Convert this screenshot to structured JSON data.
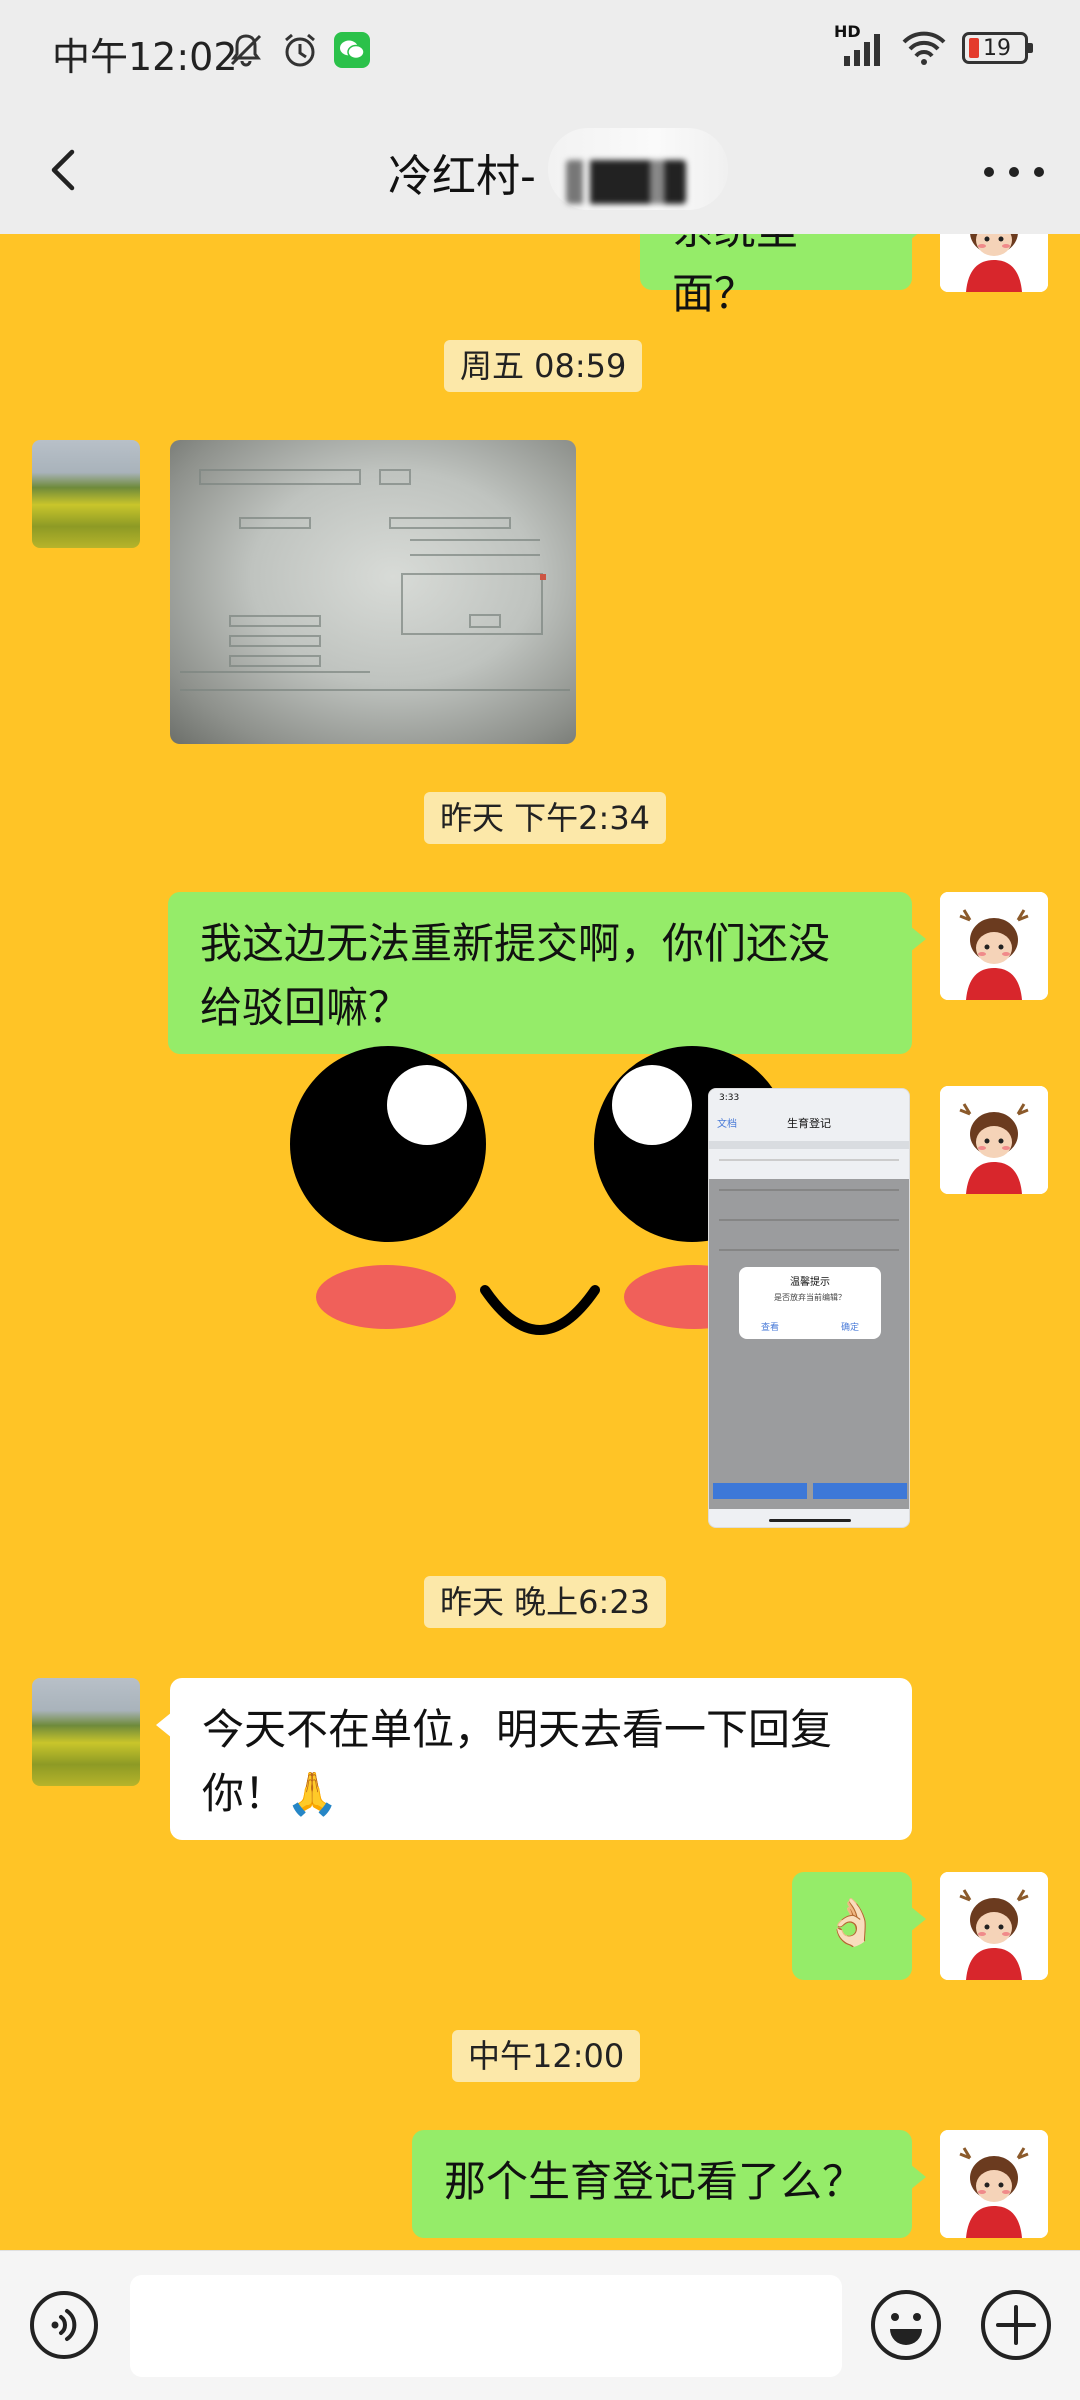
{
  "status_bar": {
    "time": "中午12:02",
    "network": "HD",
    "battery": "19"
  },
  "header": {
    "title": "冷红村-",
    "back_icon": "chevron-left-icon",
    "more_icon": "more-icon"
  },
  "messages": [
    {
      "type": "text",
      "side": "right",
      "text": "系统里面？",
      "partial": true
    },
    {
      "type": "timestamp",
      "text": "周五 08:59"
    },
    {
      "type": "image",
      "side": "left",
      "desc": "photo of a computer screen form"
    },
    {
      "type": "timestamp",
      "text": "昨天 下午2:34"
    },
    {
      "type": "text",
      "side": "right",
      "lines": [
        "我这边无法重新提交啊，你们还没",
        "给驳回嘛？"
      ]
    },
    {
      "type": "sticker_with_screenshot",
      "side": "right"
    },
    {
      "type": "timestamp",
      "text": "昨天 晚上6:23"
    },
    {
      "type": "text",
      "side": "left",
      "lines": [
        "今天不在单位，明天去看一下回复",
        "你！🙏"
      ]
    },
    {
      "type": "emoji",
      "side": "right",
      "text": "👌🏻"
    },
    {
      "type": "timestamp",
      "text": "中午12:00"
    },
    {
      "type": "text",
      "side": "right",
      "text": "那个生育登记看了么？"
    }
  ],
  "screenshot_msg": {
    "time": "3:33",
    "back": "文档",
    "title": "生育登记",
    "dialog_title": "温馨提示",
    "dialog_text": "是否放弃当前编辑？",
    "dialog_cancel": "查看",
    "dialog_ok": "确定"
  },
  "input_bar": {
    "voice_icon": "voice-icon",
    "emoji_icon": "smiley-icon",
    "plus_icon": "plus-icon",
    "placeholder": ""
  },
  "colors": {
    "chat_background": "#ffc426",
    "bubble_self": "#95ec69",
    "bubble_other": "#ffffff",
    "bar_background": "#ededed"
  }
}
